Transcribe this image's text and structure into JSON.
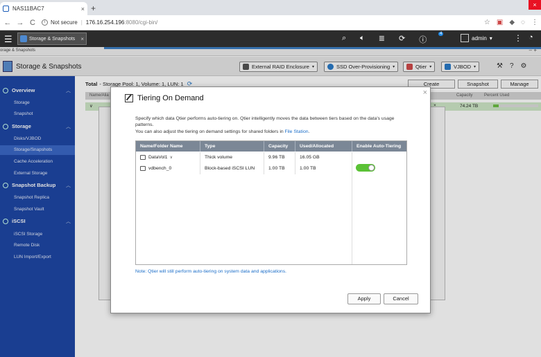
{
  "browser": {
    "tab_title": "NAS11BAC7",
    "close": "×",
    "new_tab": "+",
    "win_close": "×",
    "back": "←",
    "forward": "→",
    "reload": "C",
    "security": "Not secure",
    "url_host": "176.16.254.196",
    "url_port_path": ":8080/cgi-bin/",
    "icons": [
      "star-icon",
      "pdf-icon",
      "extension-icon",
      "circle-icon",
      "menu-icon"
    ]
  },
  "app_header": {
    "tab_label": "Storage & Snapshots",
    "tab_close": "×",
    "notification_count": "4",
    "user": "admin",
    "user_dd": "▾",
    "more": "⋮",
    "cut": "⋮"
  },
  "strip": {
    "crumb": "orage & Snapshots",
    "controls": "–  +"
  },
  "toolbar": {
    "title": "Storage & Snapshots",
    "buttons": [
      {
        "label": "External RAID Enclosure",
        "color": "#555555"
      },
      {
        "label": "SSD Over-Provisioning",
        "color": "#2a7ac8"
      },
      {
        "label": "Qtier",
        "color": "#d04b4b"
      },
      {
        "label": "VJBOD",
        "color": "#2a7ac8"
      }
    ],
    "dropdown_arrow": "▾"
  },
  "sidebar": {
    "sections": [
      {
        "label": "Overview",
        "items": [
          "Storage",
          "Snapshot"
        ]
      },
      {
        "label": "Storage",
        "items": [
          "Disks/VJBOD",
          "Storage/Snapshots",
          "Cache Acceleration",
          "External Storage"
        ]
      },
      {
        "label": "Snapshot Backup",
        "items": [
          "Snapshot Replica",
          "Snapshot Vault"
        ]
      },
      {
        "label": "iSCSI",
        "items": [
          "iSCSI Storage",
          "Remote Disk",
          "LUN Import/Export"
        ]
      }
    ],
    "active_item": "Storage/Snapshots",
    "chevron": "︿"
  },
  "main": {
    "total_label": "Total",
    "total_detail": "- Storage Pool: 1, Volume: 1, LUN: 1",
    "buttons": [
      "Create",
      "Snapshot",
      "Manage"
    ],
    "col_name": "Name/Alia",
    "col_capacity": "Capacity",
    "col_percent": "Percent Used",
    "row_capacity": "74.24 TB",
    "row_expand": "∨",
    "row_close": "×",
    "usage_fraction": 0.12
  },
  "dialog": {
    "title": "Tiering On Demand",
    "close": "×",
    "description": "Specify which data Qtier performs auto-tiering on. Qtier intelligently moves the data between tiers based on the data's usage patterns.",
    "description2_pre": "You can also adjust the tiering on demand settings for shared folders in ",
    "description2_link": "File Station",
    "description2_post": ".",
    "columns": [
      "Name/Folder Name",
      "Type",
      "Capacity",
      "Used/Allocated",
      "Enable Auto-Tiering"
    ],
    "rows": [
      {
        "name": "DataVol1",
        "type": "Thick volume",
        "capacity": "9.96 TB",
        "used": "16.05 GB",
        "auto_tiering": null
      },
      {
        "name": "vdbench_0",
        "type": "Block-based iSCSI LUN",
        "capacity": "1.00 TB",
        "used": "1.00 TB",
        "auto_tiering": true
      }
    ],
    "note": "Note: Qtier will still perform auto-tiering on system data and applications.",
    "apply_label": "Apply",
    "cancel_label": "Cancel",
    "chevron_dd": "∨"
  }
}
